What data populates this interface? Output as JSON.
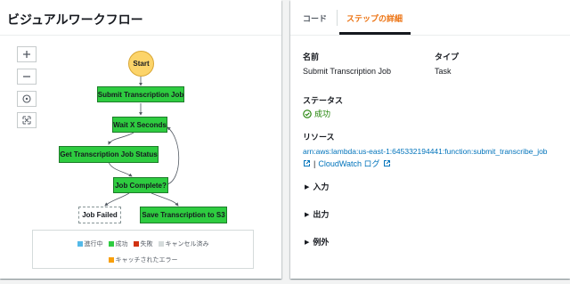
{
  "left": {
    "title": "ビジュアルワークフロー",
    "controls": [
      "zoom-in-icon",
      "zoom-out-icon",
      "center-icon",
      "fit-icon"
    ],
    "nodes": {
      "start": "Start",
      "submit": "Submit Transcription Job",
      "wait": "Wait X Seconds",
      "get": "Get Transcription Job Status",
      "complete": "Job Complete?",
      "failed": "Job Failed",
      "save": "Save Transcription to S3"
    },
    "legend": {
      "in_progress": "進行中",
      "succeeded": "成功",
      "failed": "失敗",
      "cancelled": "キャンセル済み",
      "caught": "キャッチされたエラー"
    },
    "colors": {
      "in_progress": "#54b9e8",
      "succeeded": "#2ecc40",
      "failed": "#d13212",
      "cancelled": "#d5dbdb",
      "caught": "#f89f0b"
    }
  },
  "right": {
    "tabs": {
      "code": "コード",
      "details": "ステップの詳細"
    },
    "name_label": "名前",
    "name_value": "Submit Transcription Job",
    "type_label": "タイプ",
    "type_value": "Task",
    "status_label": "ステータス",
    "status_value": "成功",
    "resource_label": "リソース",
    "resource_arn": "arn:aws:lambda:us-east-1:645332194441:function:submit_transcribe_job",
    "cloudwatch_link": "CloudWatch ログ",
    "separator": "|",
    "expanders": {
      "input": "入力",
      "output": "出力",
      "exception": "例外"
    }
  }
}
